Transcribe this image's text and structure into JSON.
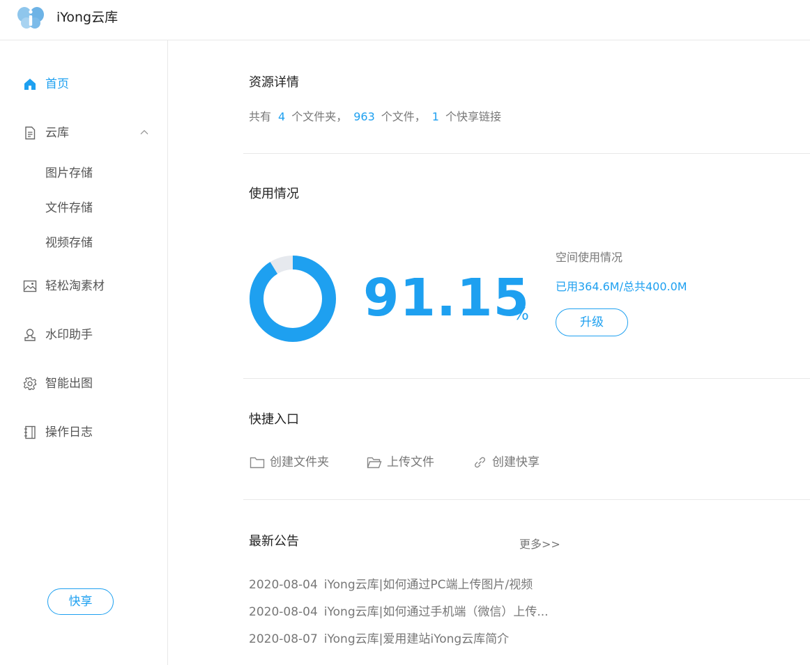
{
  "app": {
    "title": "iYong云库"
  },
  "sidebar": {
    "items": [
      {
        "label": "首页"
      },
      {
        "label": "云库"
      },
      {
        "label": "轻松淘素材"
      },
      {
        "label": "水印助手"
      },
      {
        "label": "智能出图"
      },
      {
        "label": "操作日志"
      }
    ],
    "sub_items": [
      {
        "label": "图片存储"
      },
      {
        "label": "文件存储"
      },
      {
        "label": "视频存储"
      }
    ],
    "share_button": "快享",
    "accent_color": "#1ea0f0"
  },
  "resources": {
    "title": "资源详情",
    "prefix": "共有",
    "folders": "4",
    "folders_suffix": "个文件夹，",
    "files": "963",
    "files_suffix": "个文件，",
    "links": "1",
    "links_suffix": "个快享链接"
  },
  "usage": {
    "title": "使用情况",
    "percent": "91.15",
    "percent_sign": "%",
    "used_fraction": 0.9115,
    "space_title": "空间使用情况",
    "space_text": "已用364.6M/总共400.0M",
    "upgrade_button": "升级"
  },
  "quick_entry": {
    "title": "快捷入口",
    "items": [
      {
        "label": "创建文件夹",
        "icon": "folder-icon"
      },
      {
        "label": "上传文件",
        "icon": "folder-open-icon"
      },
      {
        "label": "创建快享",
        "icon": "link-icon"
      }
    ]
  },
  "notices": {
    "title": "最新公告",
    "more": "更多>>",
    "items": [
      {
        "date": "2020-08-04",
        "text": "iYong云库|如何通过PC端上传图片/视频"
      },
      {
        "date": "2020-08-04",
        "text": "iYong云库|如何通过手机端（微信）上传..."
      },
      {
        "date": "2020-08-07",
        "text": "iYong云库|爱用建站iYong云库简介"
      }
    ]
  }
}
